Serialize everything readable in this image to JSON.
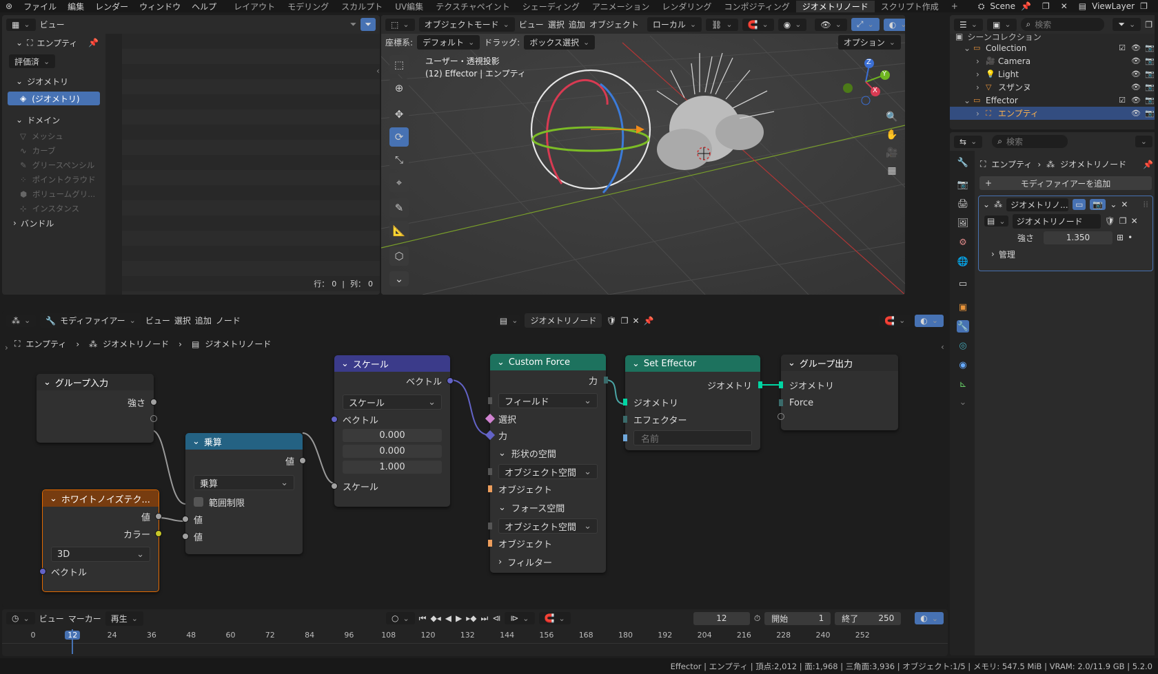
{
  "menubar": {
    "items": [
      "ファイル",
      "編集",
      "レンダー",
      "ウィンドウ",
      "ヘルプ"
    ],
    "workspaces": [
      "レイアウト",
      "モデリング",
      "スカルプト",
      "UV編集",
      "テクスチャペイント",
      "シェーディング",
      "アニメーション",
      "レンダリング",
      "コンポジティング",
      "ジオメトリノード",
      "スクリプト作成"
    ],
    "active_workspace": "ジオメトリノード",
    "add": "+",
    "scene": "Scene",
    "view_layer": "ViewLayer"
  },
  "spreadsheet": {
    "header": {
      "view": "ビュー"
    },
    "object": "エンプティ",
    "eval_mode": "評価済",
    "geometry_section": "ジオメトリ",
    "geometry_item": "(ジオメトリ)",
    "domain_section": "ドメイン",
    "domains": [
      "メッシュ",
      "カーブ",
      "グリースペンシル",
      "ポイントクラウド",
      "ボリュームグリ...",
      "インスタンス"
    ],
    "bundle": "バンドル",
    "footer": {
      "rows_label": "行：",
      "rows": "0",
      "sep": "|",
      "cols_label": "列：",
      "cols": "0"
    }
  },
  "viewport": {
    "mode": "オブジェクトモード",
    "menu": [
      "ビュー",
      "選択",
      "追加",
      "オブジェクト"
    ],
    "orientation": "ローカル",
    "coord_label": "座標系:",
    "coord_value": "デフォルト",
    "drag_label": "ドラッグ:",
    "drag_value": "ボックス選択",
    "options": "オプション",
    "info_line1": "ユーザー・透視投影",
    "info_line2": "(12) Effector | エンプティ",
    "gizmo": {
      "z": "Z",
      "y": "Y",
      "x": "X"
    }
  },
  "outliner": {
    "search_placeholder": "検索",
    "scene_collection": "シーンコレクション",
    "items": [
      {
        "name": "Collection",
        "indent": 1,
        "icon": "collection-icon"
      },
      {
        "name": "Camera",
        "indent": 2,
        "icon": "camera-icon"
      },
      {
        "name": "Light",
        "indent": 2,
        "icon": "light-icon"
      },
      {
        "name": "スザンヌ",
        "indent": 2,
        "icon": "mesh-icon"
      },
      {
        "name": "Effector",
        "indent": 1,
        "icon": "collection-icon"
      },
      {
        "name": "エンプティ",
        "indent": 2,
        "icon": "empty-icon",
        "selected": true
      }
    ]
  },
  "properties": {
    "search_placeholder": "検索",
    "breadcrumb": [
      "エンプティ",
      "ジオメトリノード"
    ],
    "add_modifier": "モディファイアーを追加",
    "modifier_name": "ジオメトリノ...",
    "node_group": "ジオメトリノード",
    "strength_label": "強さ",
    "strength_value": "1.350",
    "manage": "管理"
  },
  "node_editor": {
    "editor_type": "モディファイアー",
    "menu": [
      "ビュー",
      "選択",
      "追加",
      "ノード"
    ],
    "node_group": "ジオメトリノード",
    "breadcrumb": [
      "エンプティ",
      "ジオメトリノード",
      "ジオメトリノード"
    ],
    "nodes": {
      "group_input": {
        "title": "グループ入力",
        "strength": "強さ"
      },
      "noise": {
        "title": "ホワイトノイズテク...",
        "value": "値",
        "color": "カラー",
        "dim": "3D",
        "vector": "ベクトル"
      },
      "multiply": {
        "title": "乗算",
        "out": "値",
        "op": "乗算",
        "clamp": "範囲制限",
        "in1": "値",
        "in2": "値"
      },
      "scale": {
        "title": "スケール",
        "out": "ベクトル",
        "op": "スケール",
        "vector": "ベクトル",
        "x": "0.000",
        "y": "0.000",
        "z": "1.000",
        "scale": "スケール"
      },
      "custom_force": {
        "title": "Custom Force",
        "out": "力",
        "field": "フィールド",
        "selection": "選択",
        "force": "力",
        "shape_space": "形状の空間",
        "shape_space_value": "オブジェクト空間",
        "object1": "オブジェクト",
        "force_space": "フォース空間",
        "force_space_value": "オブジェクト空間",
        "object2": "オブジェクト",
        "filter": "フィルター"
      },
      "set_effector": {
        "title": "Set Effector",
        "out": "ジオメトリ",
        "geometry": "ジオメトリ",
        "effector": "エフェクター",
        "name_placeholder": "名前"
      },
      "group_output": {
        "title": "グループ出力",
        "geometry": "ジオメトリ",
        "force": "Force"
      }
    }
  },
  "timeline": {
    "menu": [
      "ビュー",
      "マーカー"
    ],
    "playback": "再生",
    "current_frame": "12",
    "start_label": "開始",
    "start": "1",
    "end_label": "終了",
    "end": "250",
    "ticks": [
      "0",
      "12",
      "24",
      "36",
      "48",
      "60",
      "72",
      "84",
      "96",
      "108",
      "120",
      "132",
      "144",
      "156",
      "168",
      "180",
      "192",
      "204",
      "216",
      "228",
      "240",
      "252"
    ]
  },
  "statusbar": {
    "text": "Effector | エンプティ | 頂点:2,012 | 面:1,968 | 三角面:3,936 | オブジェクト:1/5 | メモリ: 547.5 MiB | VRAM: 2.0/11.9 GB | 5.2.0"
  },
  "colors": {
    "accent": "#4772b3",
    "header_input": "#404040",
    "header_vector": "#3b3b8a",
    "header_math": "#246283",
    "header_texture": "#e66b00",
    "header_group": "#1d725e",
    "socket_float": "#a1a1a1",
    "socket_vector": "#6363c7",
    "socket_geometry": "#00d6a3",
    "socket_color": "#c7c729",
    "socket_object": "#ed9e5c"
  }
}
